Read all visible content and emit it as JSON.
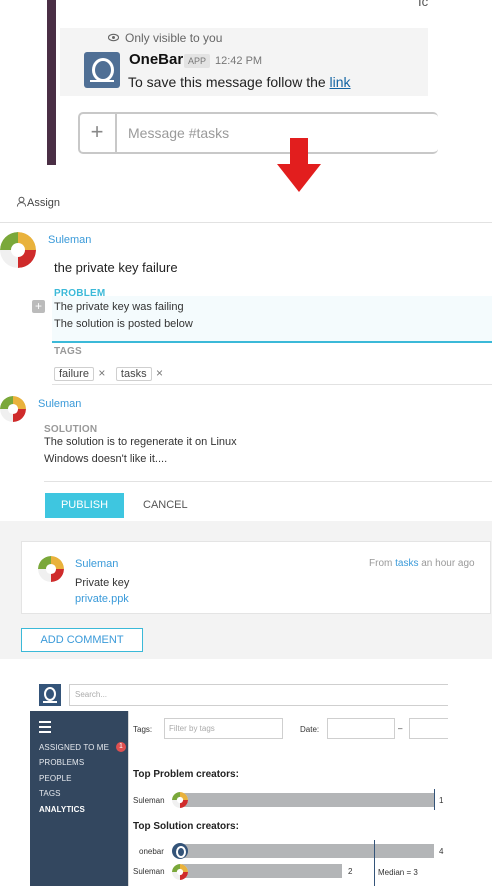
{
  "slack": {
    "visibility_note": "Only visible to you",
    "bot_name": "OneBar",
    "app_badge": "APP",
    "time": "12:42 PM",
    "message_text": "To save this message follow the ",
    "message_link": "link",
    "composer_placeholder": "Message #tasks",
    "composer_plus": "+",
    "top_fragment": "Ic"
  },
  "editor": {
    "assign_label": "Assign",
    "author": "Suleman",
    "title": "the private key failure",
    "problem_label": "PROBLEM",
    "problem_lines": [
      "The private key was failing",
      "The solution is posted below"
    ],
    "tags_label": "TAGS",
    "tags": [
      "failure",
      "tasks"
    ],
    "tag_remove": "×",
    "solution_author": "Suleman",
    "solution_label": "SOLUTION",
    "solution_lines": [
      "The solution is to regenerate it on Linux",
      "Windows doesn't like it...."
    ],
    "publish_label": "PUBLISH",
    "cancel_label": "CANCEL"
  },
  "comment": {
    "author": "Suleman",
    "from_prefix": "From ",
    "from_channel": "tasks",
    "from_suffix": " an hour ago",
    "text": "Private key",
    "attachment": "private.ppk",
    "add_comment_label": "ADD COMMENT"
  },
  "analytics": {
    "search_placeholder": "Search...",
    "sidebar": [
      {
        "label": "ASSIGNED TO ME",
        "badge": "1"
      },
      {
        "label": "PROBLEMS"
      },
      {
        "label": "PEOPLE"
      },
      {
        "label": "TAGS"
      },
      {
        "label": "ANALYTICS",
        "active": true
      }
    ],
    "tags_label": "Tags:",
    "tags_placeholder": "Filter by tags",
    "date_label": "Date:",
    "date_sep": "–",
    "problem_heading": "Top Problem creators:",
    "problem_rows": [
      {
        "name": "Suleman",
        "value": "1"
      }
    ],
    "solution_heading": "Top Solution creators:",
    "solution_rows": [
      {
        "name": "onebar",
        "value": "4"
      },
      {
        "name": "Suleman",
        "value": "2"
      }
    ],
    "median_label": "Median = 3"
  },
  "colors": {
    "slack_sidebar": "#4a2f45",
    "accent": "#3bb9d8",
    "link": "#3a9ad9",
    "app_sidebar": "#33475f",
    "arrow": "#e21e1e"
  }
}
